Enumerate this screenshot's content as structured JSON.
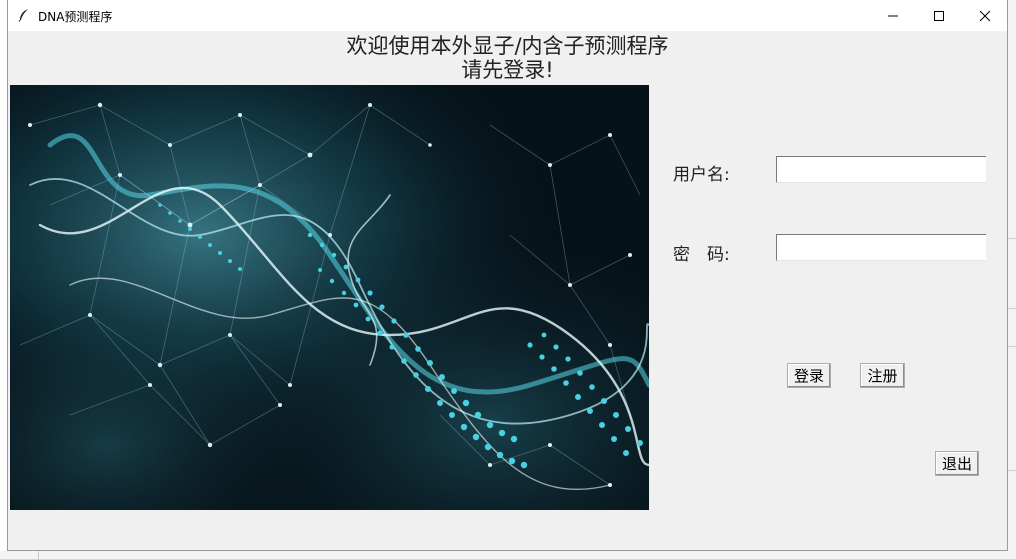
{
  "window": {
    "title": "DNA预测程序",
    "controls": {
      "minimize": "—",
      "maximize": "☐",
      "close": "✕"
    }
  },
  "heading": {
    "line1": "欢迎使用本外显子/内含子预测程序",
    "line2": "请先登录!"
  },
  "form": {
    "username_label": "用户名:",
    "username_value": "",
    "password_label": "密　码:",
    "password_value": ""
  },
  "buttons": {
    "login": "登录",
    "register": "注册",
    "exit": "退出"
  },
  "hero_image": {
    "description_icon": "dna-helix-image"
  },
  "colors": {
    "accent": "#39c6d6",
    "window_bg": "#f0f0f0",
    "image_bg": "#040a10"
  }
}
